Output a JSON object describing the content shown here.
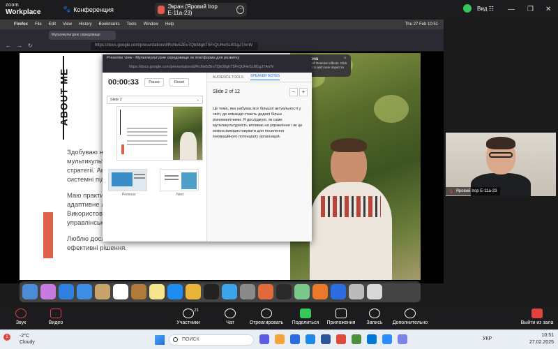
{
  "zoom": {
    "logo_line1": "zoom",
    "logo_line2": "Workplace",
    "meeting_label": "Конференция",
    "shared_screen_label": "Экран (Яровий Ігор Е-11а-23)",
    "view_label": "Вид"
  },
  "mac_menubar": {
    "app": "Firefox",
    "items": [
      "File",
      "Edit",
      "View",
      "History",
      "Bookmarks",
      "Tools",
      "Window",
      "Help"
    ],
    "clock": "Thu 27 Feb 10:51"
  },
  "firefox": {
    "tab_title": "Мультикультурне середовище",
    "url": "https://docs.google.com/presentation/d/RcNe5ZEv7Qb38ghT5FrQUHeSL6f1gJ7AnW"
  },
  "slide": {
    "heading": "ABOUT ME",
    "text_lines": [
      "Здобуваю на",
      "мультикульту",
      "стратегії. Авт",
      "системні підх",
      "",
      "Маю практич",
      "адаптивне лі",
      "Використову",
      "управлінськи",
      "",
      "Люблю дослі",
      "ефективні рішення."
    ]
  },
  "presenter_view": {
    "window_title": "Presenter view - Мультикультурне середовище як платформа для розвитку",
    "url": "https://docs.google.com/presentation/d/RcNe5ZEv7Qb38ghT5FrQUHeSL6f1gJ7AnW",
    "timer": "00:00:33",
    "pause_label": "Pause",
    "reset_label": "Reset",
    "slide_select": "Slide 2",
    "prev_caption": "Previous",
    "next_caption": "Next",
    "tabs": [
      "AUDIENCE TOOLS",
      "SPEAKER NOTES"
    ],
    "slide_counter": "Slide 2 of 12",
    "zoom_minus": "−",
    "zoom_plus": "+",
    "notes": "Це тема, яка набуває все більшої актуальності у світі, де команди стають дедалі більш різноманітними. Я досліджую, як саме мультикультурність впливає на управління і як це можна використовувати для посилення інноваційного потенціалу організацій."
  },
  "toast": {
    "title": "Turn On Reactions",
    "body": "\"zoom.us\" has turned off Reaction effects. Click ⓘ and select Reaction to add more impact to your gestures.",
    "close": "×"
  },
  "participant": {
    "name": "Яровий Ігор Е-11а-23"
  },
  "toolbar": {
    "mute": "Звук",
    "video": "Видео",
    "participants": "Участники",
    "participants_count": "21",
    "chat": "Чат",
    "react": "Отреагировать",
    "share": "Поделиться",
    "apps": "Приложения",
    "record": "Запись",
    "more": "Дополнительно",
    "leave": "Выйти из зала"
  },
  "taskbar": {
    "weather_temp": "-2°C",
    "weather_desc": "Cloudy",
    "weather_badge": "1",
    "search_placeholder": "ПОИСК",
    "lang": "УКР",
    "time": "10:51",
    "date": "27.02.2025"
  },
  "colors": {
    "accent_red": "#e0604e",
    "zoom_dark": "#1c1c1e",
    "link_blue": "#1a73e8"
  }
}
